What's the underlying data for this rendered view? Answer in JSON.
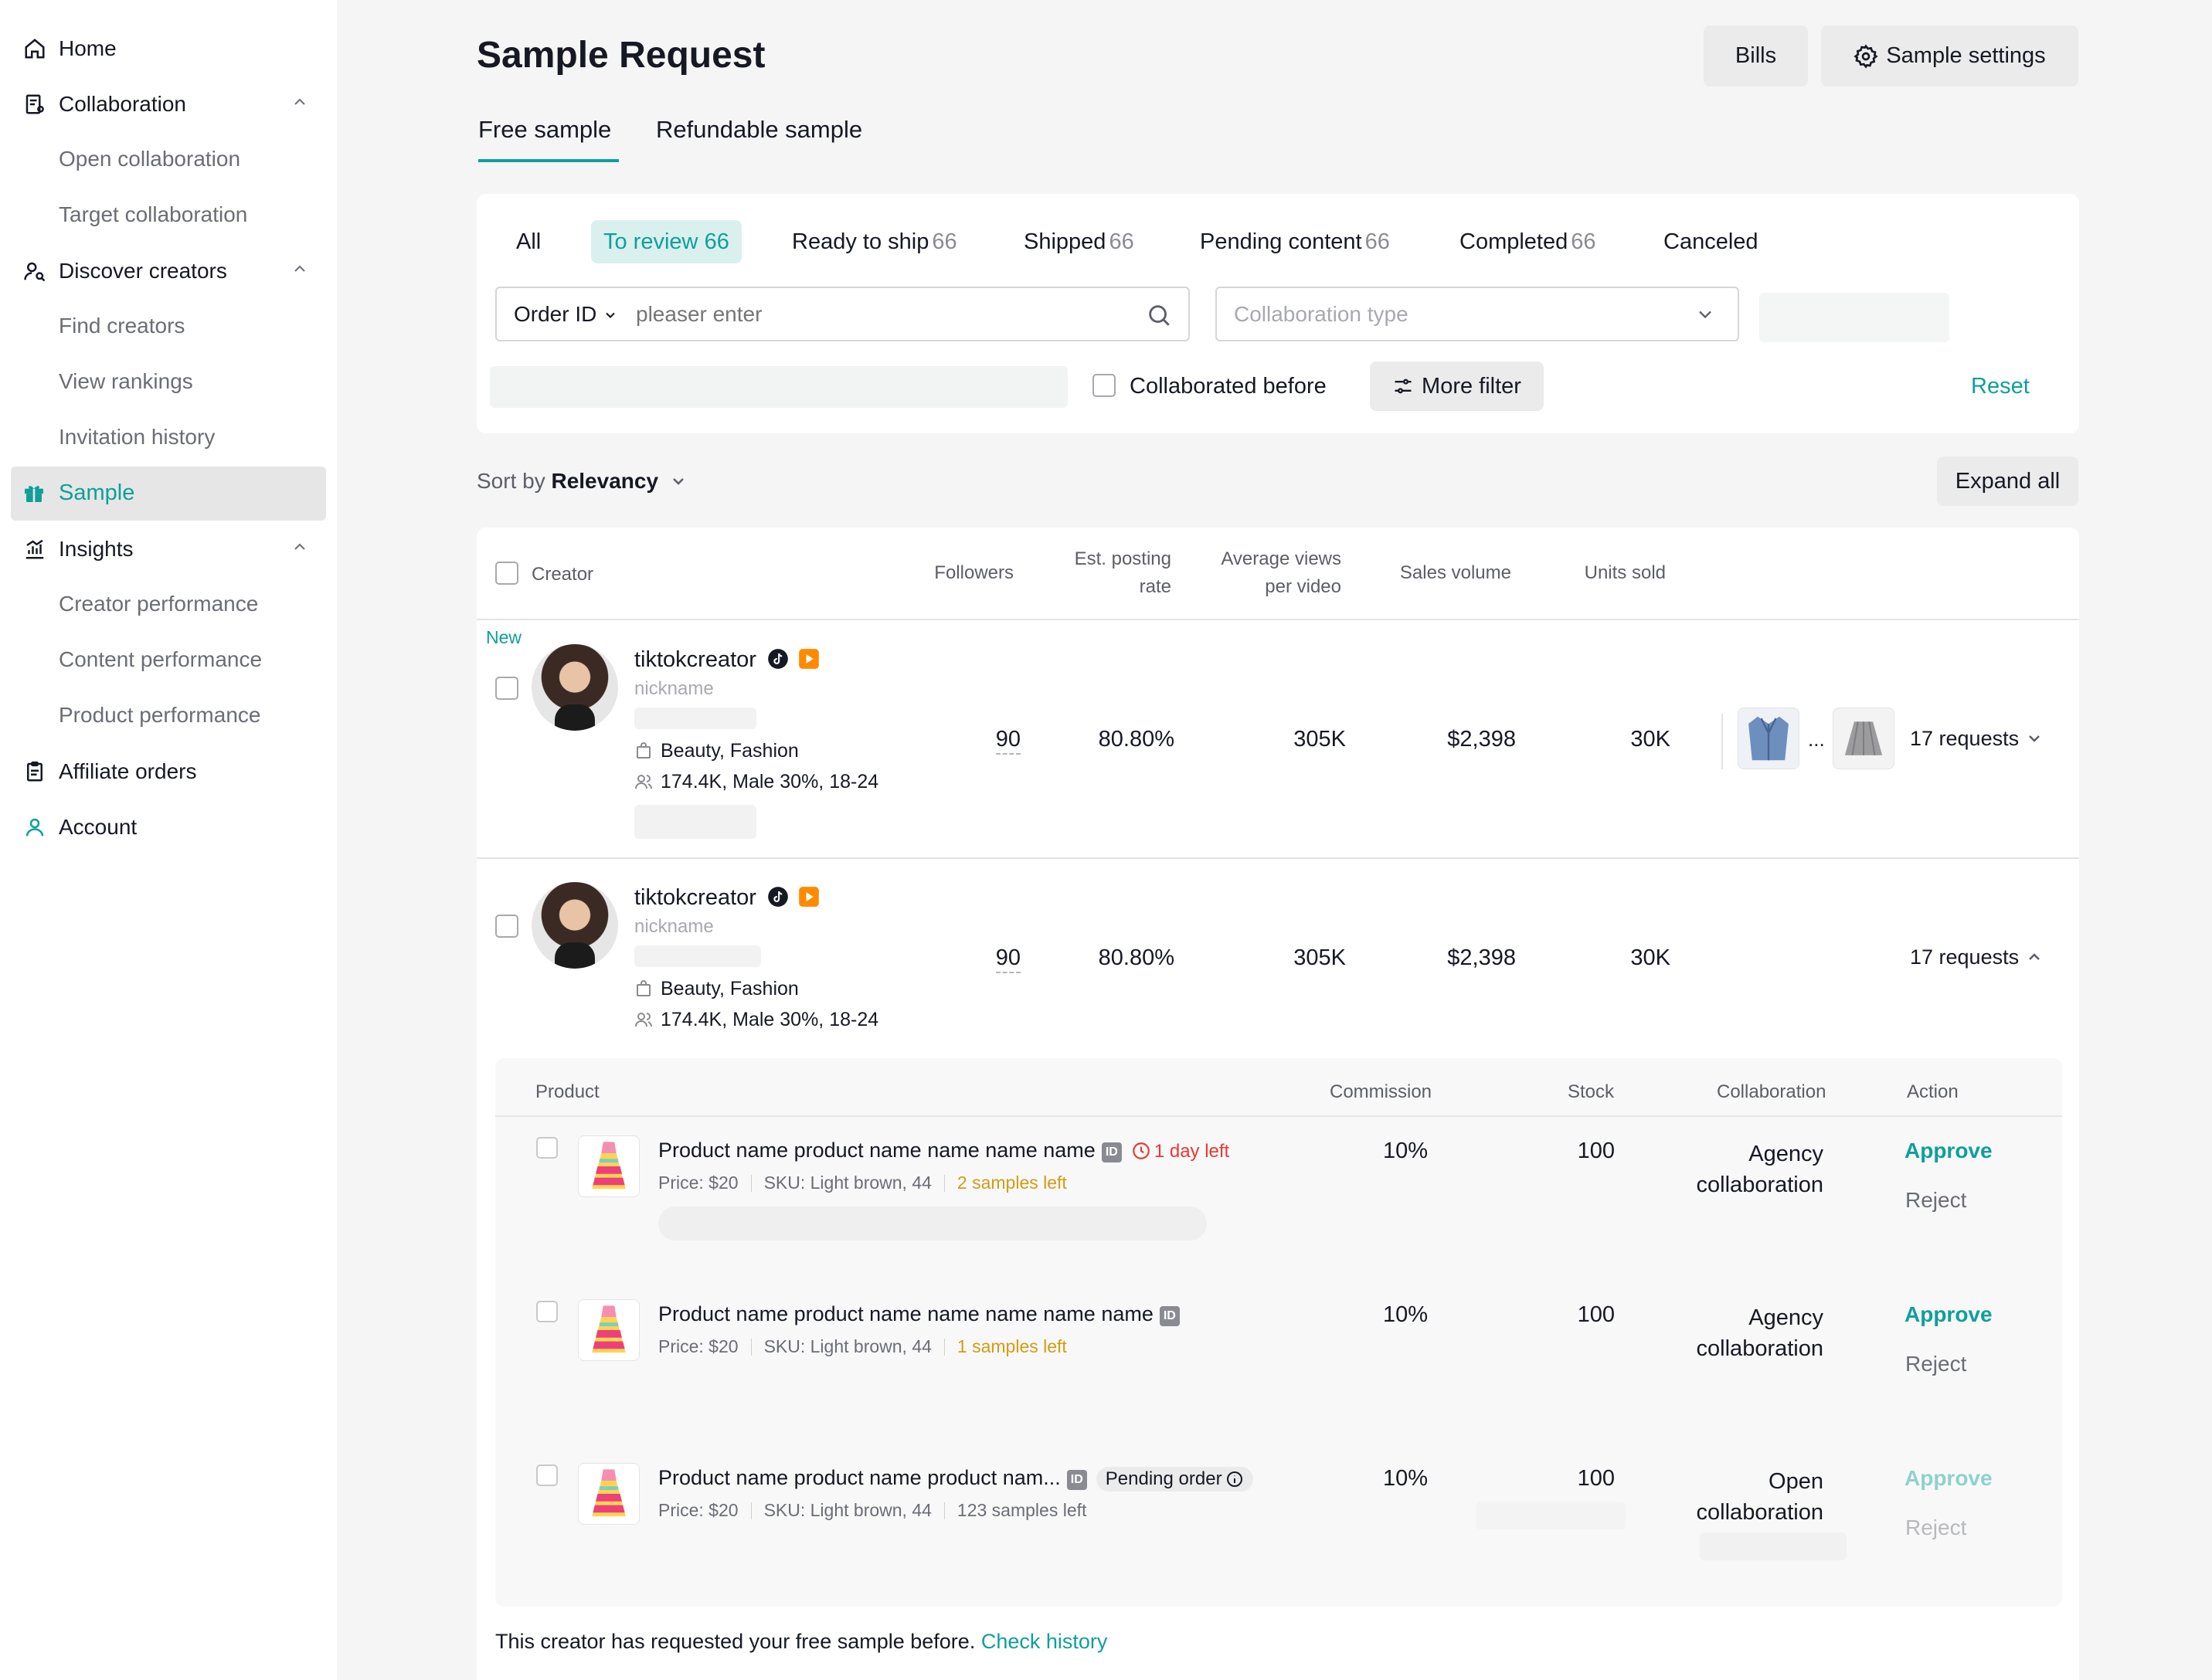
{
  "sidebar": {
    "items": [
      {
        "label": "Home",
        "icon": "home-icon"
      },
      {
        "label": "Collaboration",
        "icon": "collaboration-icon"
      },
      {
        "label": "Discover creators",
        "icon": "discover-creators-icon"
      },
      {
        "label": "Sample",
        "icon": "gift-icon"
      },
      {
        "label": "Insights",
        "icon": "insights-chart-icon"
      },
      {
        "label": "Affiliate orders",
        "icon": "clipboard-icon"
      },
      {
        "label": "Account",
        "icon": "user-icon"
      }
    ],
    "sub": {
      "collaboration": [
        "Open collaboration",
        "Target collaboration"
      ],
      "discover": [
        "Find creators",
        "View rankings",
        "Invitation history"
      ],
      "insights": [
        "Creator performance",
        "Content performance",
        "Product performance"
      ]
    },
    "active_color": "#0f9f9a"
  },
  "header": {
    "title": "Sample Request",
    "bills_label": "Bills",
    "settings_label": "Sample settings",
    "tabs": [
      "Free sample",
      "Refundable sample"
    ]
  },
  "status_tabs": [
    {
      "label": "All",
      "count": ""
    },
    {
      "label": "To review",
      "count": "66"
    },
    {
      "label": "Ready to ship",
      "count": "66"
    },
    {
      "label": "Shipped",
      "count": "66"
    },
    {
      "label": "Pending content",
      "count": "66"
    },
    {
      "label": "Completed",
      "count": "66"
    },
    {
      "label": "Canceled",
      "count": ""
    }
  ],
  "filters": {
    "order_select": "Order ID",
    "search_placeholder": "pleaser enter",
    "collab_placeholder": "Collaboration type",
    "collaborated_before": "Collaborated before",
    "more_filter": "More filter",
    "reset": "Reset"
  },
  "sort": {
    "prefix": "Sort by",
    "value": "Relevancy",
    "expand_all": "Expand all"
  },
  "table": {
    "headers": {
      "creator": "Creator",
      "followers": "Followers",
      "posting_1": "Est. posting",
      "posting_2": "rate",
      "views_1": "Average views",
      "views_2": "per video",
      "sales": "Sales volume",
      "units": "Units sold"
    },
    "rows": [
      {
        "badge": "New",
        "name": "tiktokcreator",
        "nickname": "nickname",
        "category": "Beauty, Fashion",
        "audience": "174.4K, Male 30%, 18-24",
        "followers": "90",
        "posting_rate": "80.80%",
        "avg_views": "305K",
        "sales": "$2,398",
        "units": "30K",
        "requests": "17 requests"
      },
      {
        "name": "tiktokcreator",
        "nickname": "nickname",
        "category": "Beauty, Fashion",
        "audience": "174.4K, Male 30%, 18-24",
        "followers": "90",
        "posting_rate": "80.80%",
        "avg_views": "305K",
        "sales": "$2,398",
        "units": "30K",
        "requests": "17 requests"
      }
    ],
    "ellipsis": "..."
  },
  "sub_table": {
    "headers": {
      "product": "Product",
      "commission": "Commission",
      "stock": "Stock",
      "collaboration": "Collaboration",
      "action": "Action"
    },
    "id_badge": "ID",
    "rows": [
      {
        "name": "Product name product name name name name",
        "tag": "1 day left",
        "price": "Price: $20",
        "sku": "SKU: Light brown, 44",
        "samples": "2 samples left",
        "commission": "10%",
        "stock": "100",
        "collab_1": "Agency",
        "collab_2": "collaboration",
        "approve": "Approve",
        "reject": "Reject"
      },
      {
        "name": "Product name product name name name name name",
        "price": "Price: $20",
        "sku": "SKU: Light brown, 44",
        "samples": "1 samples left",
        "commission": "10%",
        "stock": "100",
        "collab_1": "Agency",
        "collab_2": "collaboration",
        "approve": "Approve",
        "reject": "Reject"
      },
      {
        "name": "Product name product name product nam...",
        "pending": "Pending order",
        "price": "Price: $20",
        "sku": "SKU: Light brown, 44",
        "samples": "123 samples left",
        "commission": "10%",
        "stock": "100",
        "collab_1": "Open",
        "collab_2": "collaboration",
        "approve": "Approve",
        "reject": "Reject"
      }
    ]
  },
  "footer": {
    "note": "This creator has requested your free sample before.",
    "link": "Check history"
  }
}
